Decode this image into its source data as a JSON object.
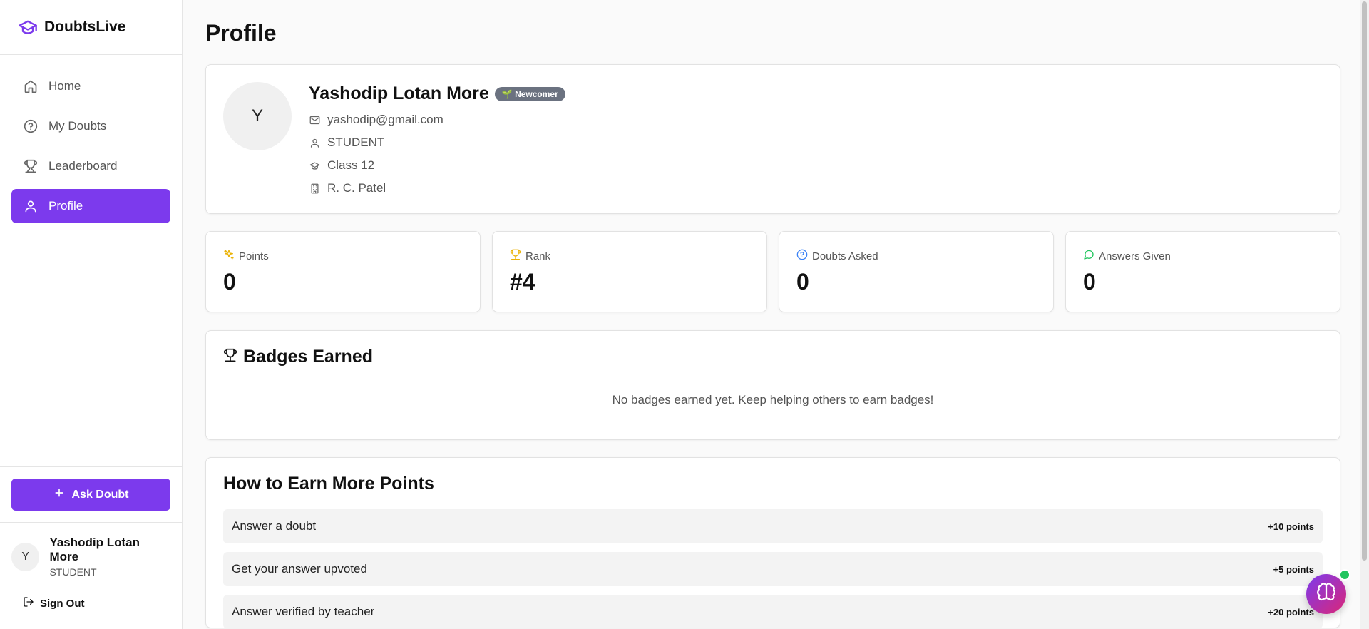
{
  "brand": {
    "name": "DoubtsLive",
    "icon": "graduation-cap-icon"
  },
  "colors": {
    "accent": "#7c3aed",
    "badge_bg": "#6b7280",
    "online": "#22c55e"
  },
  "nav": {
    "items": [
      {
        "label": "Home",
        "icon": "home-icon",
        "active": false
      },
      {
        "label": "My Doubts",
        "icon": "question-circle-icon",
        "active": false
      },
      {
        "label": "Leaderboard",
        "icon": "trophy-icon",
        "active": false
      },
      {
        "label": "Profile",
        "icon": "user-icon",
        "active": true
      }
    ]
  },
  "sidebar": {
    "ask_label": "Ask Doubt",
    "user": {
      "initial": "Y",
      "name": "Yashodip Lotan More",
      "role": "STUDENT"
    },
    "signout_label": "Sign Out"
  },
  "page": {
    "title": "Profile"
  },
  "profile": {
    "initial": "Y",
    "name": "Yashodip Lotan More",
    "badge": "🌱 Newcomer",
    "email": "yashodip@gmail.com",
    "role": "STUDENT",
    "class": "Class 12",
    "school": "R. C. Patel"
  },
  "stats": [
    {
      "label": "Points",
      "value": "0",
      "icon": "sparkles-icon",
      "color": "#eab308"
    },
    {
      "label": "Rank",
      "value": "#4",
      "icon": "trophy-icon",
      "color": "#eab308"
    },
    {
      "label": "Doubts Asked",
      "value": "0",
      "icon": "question-circle-icon",
      "color": "#3b82f6"
    },
    {
      "label": "Answers Given",
      "value": "0",
      "icon": "message-circle-icon",
      "color": "#22c55e"
    }
  ],
  "badges": {
    "title": "Badges Earned",
    "empty": "No badges earned yet. Keep helping others to earn badges!"
  },
  "earn": {
    "title": "How to Earn More Points",
    "rows": [
      {
        "label": "Answer a doubt",
        "points": "+10 points"
      },
      {
        "label": "Get your answer upvoted",
        "points": "+5 points"
      },
      {
        "label": "Answer verified by teacher",
        "points": "+20 points"
      }
    ]
  },
  "fab": {
    "icon": "brain-icon"
  }
}
